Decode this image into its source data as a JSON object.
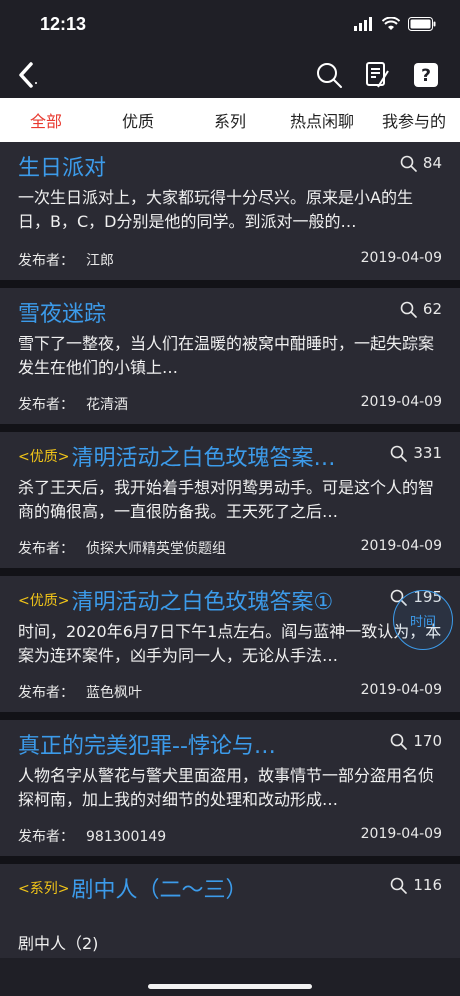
{
  "status_bar": {
    "time": "12:13"
  },
  "nav": {
    "icons": [
      "back-icon",
      "search-icon",
      "edit-icon",
      "help-icon"
    ]
  },
  "tabs": [
    {
      "label": "全部",
      "active": true
    },
    {
      "label": "优质",
      "active": false
    },
    {
      "label": "系列",
      "active": false
    },
    {
      "label": "热点闲聊",
      "active": false
    },
    {
      "label": "我参与的",
      "active": false
    }
  ],
  "posts": [
    {
      "tag": "",
      "title": "生日派对",
      "views": "84",
      "excerpt": "一次生日派对上，大家都玩得十分尽兴。原来是小A的生日，B，C，D分别是他的同学。到派对一般的…",
      "author_label": "发布者：",
      "author": "江郎",
      "date": "2019-04-09"
    },
    {
      "tag": "",
      "title": "雪夜迷踪",
      "views": "62",
      "excerpt": "雪下了一整夜，当人们在温暖的被窝中酣睡时，一起失踪案发生在他们的小镇上…",
      "author_label": "发布者：",
      "author": "花清酒",
      "date": "2019-04-09"
    },
    {
      "tag": "<优质>",
      "title": "清明活动之白色玫瑰答案…",
      "views": "331",
      "excerpt": "杀了王天后，我开始着手想对阴鸷男动手。可是这个人的智商的确很高，一直很防备我。王天死了之后…",
      "author_label": "发布者：",
      "author": "侦探大师精英堂侦题组",
      "date": "2019-04-09"
    },
    {
      "tag": "<优质>",
      "title": "清明活动之白色玫瑰答案①",
      "views": "195",
      "excerpt": "  时间，2020年6月7日下午1点左右。阎与蓝神一致认为，本案为连环案件，凶手为同一人，无论从手法…",
      "author_label": "发布者：",
      "author": "蓝色枫叶",
      "date": "2019-04-09"
    },
    {
      "tag": "",
      "title": "真正的完美犯罪--悖论与…",
      "views": "170",
      "excerpt": "人物名字从警花与警犬里面盗用，故事情节一部分盗用名侦探柯南，加上我的对细节的处理和改动形成…",
      "author_label": "发布者：",
      "author": "981300149",
      "date": "2019-04-09"
    },
    {
      "tag": "<系列>",
      "title": "剧中人（二～三）",
      "views": "116",
      "excerpt": "",
      "sub_item": "剧中人（2)",
      "author_label": "",
      "author": "",
      "date": ""
    }
  ],
  "float_bubble": {
    "label": "时间"
  }
}
